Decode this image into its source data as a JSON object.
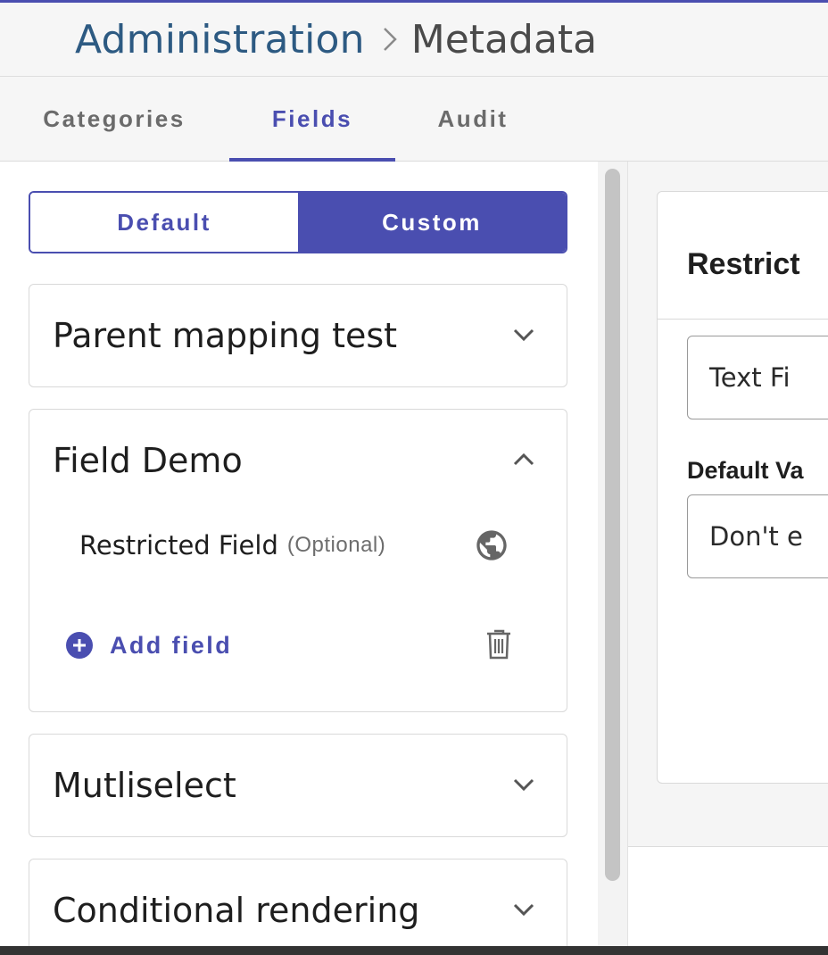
{
  "breadcrumb": {
    "root": "Administration",
    "current": "Metadata"
  },
  "tabs": [
    {
      "label": "Categories",
      "active": false
    },
    {
      "label": "Fields",
      "active": true
    },
    {
      "label": "Audit",
      "active": false
    }
  ],
  "toggle": {
    "default_label": "Default",
    "custom_label": "Custom",
    "selected": "Custom"
  },
  "groups": [
    {
      "title": "Parent mapping test",
      "expanded": false
    },
    {
      "title": "Field Demo",
      "expanded": true,
      "fields": [
        {
          "name": "Restricted Field",
          "qualifier": "(Optional)",
          "icon": "globe-icon"
        }
      ],
      "add_field_label": "Add field"
    },
    {
      "title": "Mutliselect",
      "expanded": false
    },
    {
      "title": "Conditional rendering",
      "expanded": false
    }
  ],
  "detail": {
    "title": "Restrict",
    "field_type_value": "Text Fi",
    "default_value_label": "Default Va",
    "default_value_text": "Don't e"
  },
  "colors": {
    "accent": "#4a4eb0",
    "breadcrumb_root": "#2d5a82"
  }
}
